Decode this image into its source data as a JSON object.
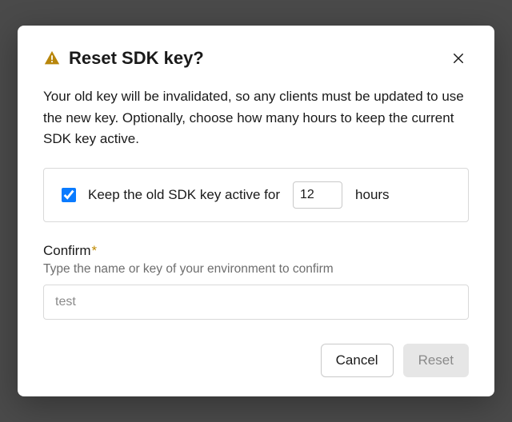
{
  "dialog": {
    "title": "Reset SDK key?",
    "body": "Your old key will be invalidated, so any clients must be updated to use the new key. Optionally, choose how many hours to keep the current SDK key active.",
    "option": {
      "checked": true,
      "label_before": "Keep the old SDK key active for",
      "hours_value": "12",
      "label_after": "hours"
    },
    "confirm": {
      "label": "Confirm",
      "required_mark": "*",
      "help": "Type the name or key of your environment to confirm",
      "placeholder": "test",
      "value": ""
    },
    "buttons": {
      "cancel": "Cancel",
      "reset": "Reset"
    }
  }
}
